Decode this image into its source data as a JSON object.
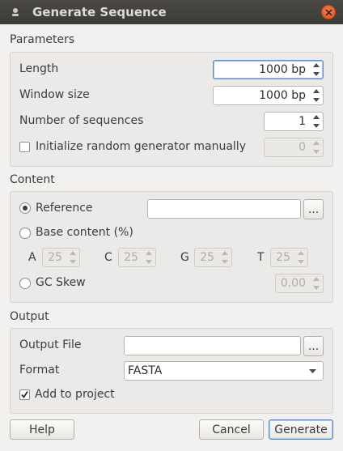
{
  "window": {
    "title": "Generate Sequence"
  },
  "parameters": {
    "title": "Parameters",
    "length": {
      "label": "Length",
      "value": "1000 bp"
    },
    "window_size": {
      "label": "Window size",
      "value": "1000 bp"
    },
    "num_sequences": {
      "label": "Number of sequences",
      "value": "1"
    },
    "init_random": {
      "label": "Initialize random generator manually",
      "checked": false,
      "value": "0"
    }
  },
  "content": {
    "title": "Content",
    "reference": {
      "label": "Reference",
      "selected": true,
      "value": "",
      "browse_label": "..."
    },
    "base_content": {
      "label": "Base content (%)",
      "selected": false
    },
    "bases": [
      {
        "label": "A",
        "value": "25"
      },
      {
        "label": "C",
        "value": "25"
      },
      {
        "label": "G",
        "value": "25"
      },
      {
        "label": "T",
        "value": "25"
      }
    ],
    "gc_skew": {
      "label": "GC Skew",
      "selected": false,
      "value": "0.00"
    }
  },
  "output": {
    "title": "Output",
    "output_file": {
      "label": "Output File",
      "value": "",
      "browse_label": "..."
    },
    "format": {
      "label": "Format",
      "value": "FASTA"
    },
    "add_to_project": {
      "label": "Add to project",
      "checked": true
    }
  },
  "buttons": {
    "help": "Help",
    "cancel": "Cancel",
    "generate": "Generate"
  },
  "colors": {
    "accent": "#5f8fc8",
    "close": "#e9632f",
    "titlebar": "#3c3b37"
  }
}
